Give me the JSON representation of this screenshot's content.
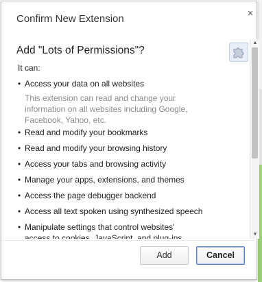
{
  "dialog": {
    "title": "Confirm New Extension",
    "close_glyph": "×",
    "heading": "Add \"Lots of Permissions\"?",
    "intro": "It can:",
    "permissions": [
      "Access your data on all websites",
      "Read and modify your bookmarks",
      "Read and modify your browsing history",
      "Access your tabs and browsing activity",
      "Manage your apps, extensions, and themes",
      "Access the page debugger backend",
      "Access all text spoken using synthesized speech",
      "Manipulate settings that control websites'",
      "access to cookies, JavaScript, and plug-ins"
    ],
    "permission_detail": "This extension can read and change your information on all websites including Google, Facebook, Yahoo, etc.",
    "bullet": "•"
  },
  "buttons": {
    "add_label": "Add",
    "cancel_label": "Cancel"
  },
  "scrollbar": {
    "up_glyph": "▲",
    "down_glyph": "▼"
  },
  "colors": {
    "cancel_border": "#5b7ec9",
    "detail_text": "#8c8c8c",
    "extension_icon_bg": "#e9eef8"
  },
  "icons": {
    "extension": "puzzle-piece-icon",
    "close": "close-icon"
  }
}
